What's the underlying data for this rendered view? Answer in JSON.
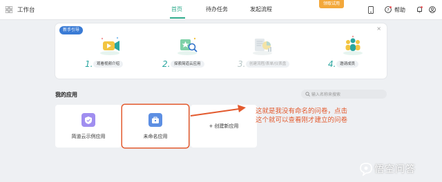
{
  "header": {
    "workbench_label": "工作台",
    "tabs": [
      {
        "label": "首页",
        "active": true
      },
      {
        "label": "待办任务",
        "active": false
      },
      {
        "label": "发起流程",
        "active": false
      }
    ],
    "trial_badge": "领取试用",
    "help_label": "帮助"
  },
  "guide": {
    "badge": "新手引导",
    "close_label": "×",
    "steps": [
      {
        "num": "1.",
        "label": "观看视频介绍",
        "icon": "video-icon",
        "muted": false
      },
      {
        "num": "2.",
        "label": "探索简道云应用",
        "icon": "explore-icon",
        "muted": false
      },
      {
        "num": "3.",
        "label": "创建流程/表单/仪表盘",
        "icon": "chart-doc-icon",
        "muted": true
      },
      {
        "num": "4.",
        "label": "邀请成员",
        "icon": "team-icon",
        "muted": false
      }
    ]
  },
  "apps": {
    "title": "我的应用",
    "search_placeholder": "输入名称来搜索",
    "cards": [
      {
        "label": "简道云示例应用",
        "icon": "shield-icon",
        "color": "#a08ef0"
      },
      {
        "label": "未命名应用",
        "icon": "briefcase-icon",
        "color": "#5d8fe3"
      }
    ],
    "create_label": "+ 创建新应用"
  },
  "annotation": {
    "line1": "这就是我没有命名的问卷，点击",
    "line2": "这个就可以查看刚才建立的问卷"
  },
  "watermark": {
    "text": "悟空问答"
  },
  "colors": {
    "accent": "#2fab8c",
    "annotation": "#e35a2e",
    "trial_badge": "#f3a83b"
  }
}
